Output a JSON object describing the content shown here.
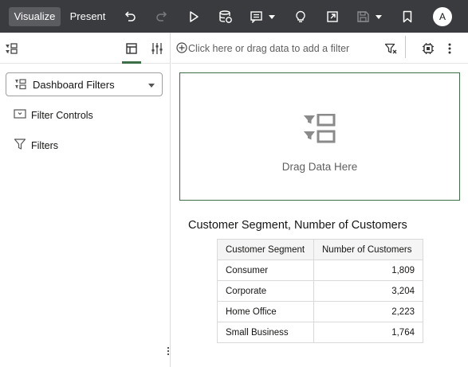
{
  "toolbar": {
    "visualize_label": "Visualize",
    "present_label": "Present",
    "avatar_initial": "A",
    "icons": [
      "undo-icon",
      "redo-icon",
      "play-icon",
      "data-refresh-icon",
      "comment-menu-icon",
      "insight-lightbulb-icon",
      "export-icon",
      "save-menu-icon",
      "bookmark-icon"
    ]
  },
  "left_panel": {
    "header_icons": [
      "data-panel-icon",
      "visualizations-tab-icon",
      "settings-sliders-icon"
    ],
    "dropdown": {
      "label": "Dashboard Filters"
    },
    "items": [
      {
        "label": "Filter Controls",
        "icon": "filter-controls-icon"
      },
      {
        "label": "Filters",
        "icon": "funnel-icon"
      }
    ]
  },
  "filter_bar": {
    "placeholder": "Click here or drag data to add a filter",
    "icons": [
      "add-icon",
      "filter-toggle-icon",
      "auto-apply-icon",
      "more-options-icon"
    ]
  },
  "canvas": {
    "drop_zone_label": "Drag Data Here"
  },
  "visualization": {
    "title": "Customer Segment, Number of Customers",
    "columns": [
      "Customer Segment",
      "Number of Customers"
    ],
    "rows": [
      {
        "segment": "Consumer",
        "count": "1,809"
      },
      {
        "segment": "Corporate",
        "count": "3,204"
      },
      {
        "segment": "Home Office",
        "count": "2,223"
      },
      {
        "segment": "Small Business",
        "count": "1,764"
      }
    ]
  },
  "colors": {
    "toolbar_bg": "#3a3b3e",
    "active_button_bg": "#5b5c60",
    "accent_green": "#3c6e47"
  }
}
